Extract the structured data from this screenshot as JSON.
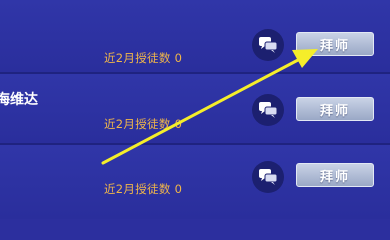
{
  "rows": [
    {
      "name": "",
      "count_text": "近2月授徒数 0",
      "button_label": "拜师"
    },
    {
      "name": "海维达",
      "count_text": "近2月授徒数 0",
      "button_label": "拜师"
    },
    {
      "name": "",
      "count_text": "近2月授徒数 0",
      "button_label": "拜师"
    }
  ],
  "icons": {
    "chat": "chat-bubbles-icon"
  },
  "colors": {
    "background": "#2c2f9e",
    "count_text": "#f0b64a",
    "button": "#b3bfd8",
    "annotation_arrow": "#f5ee2a"
  }
}
